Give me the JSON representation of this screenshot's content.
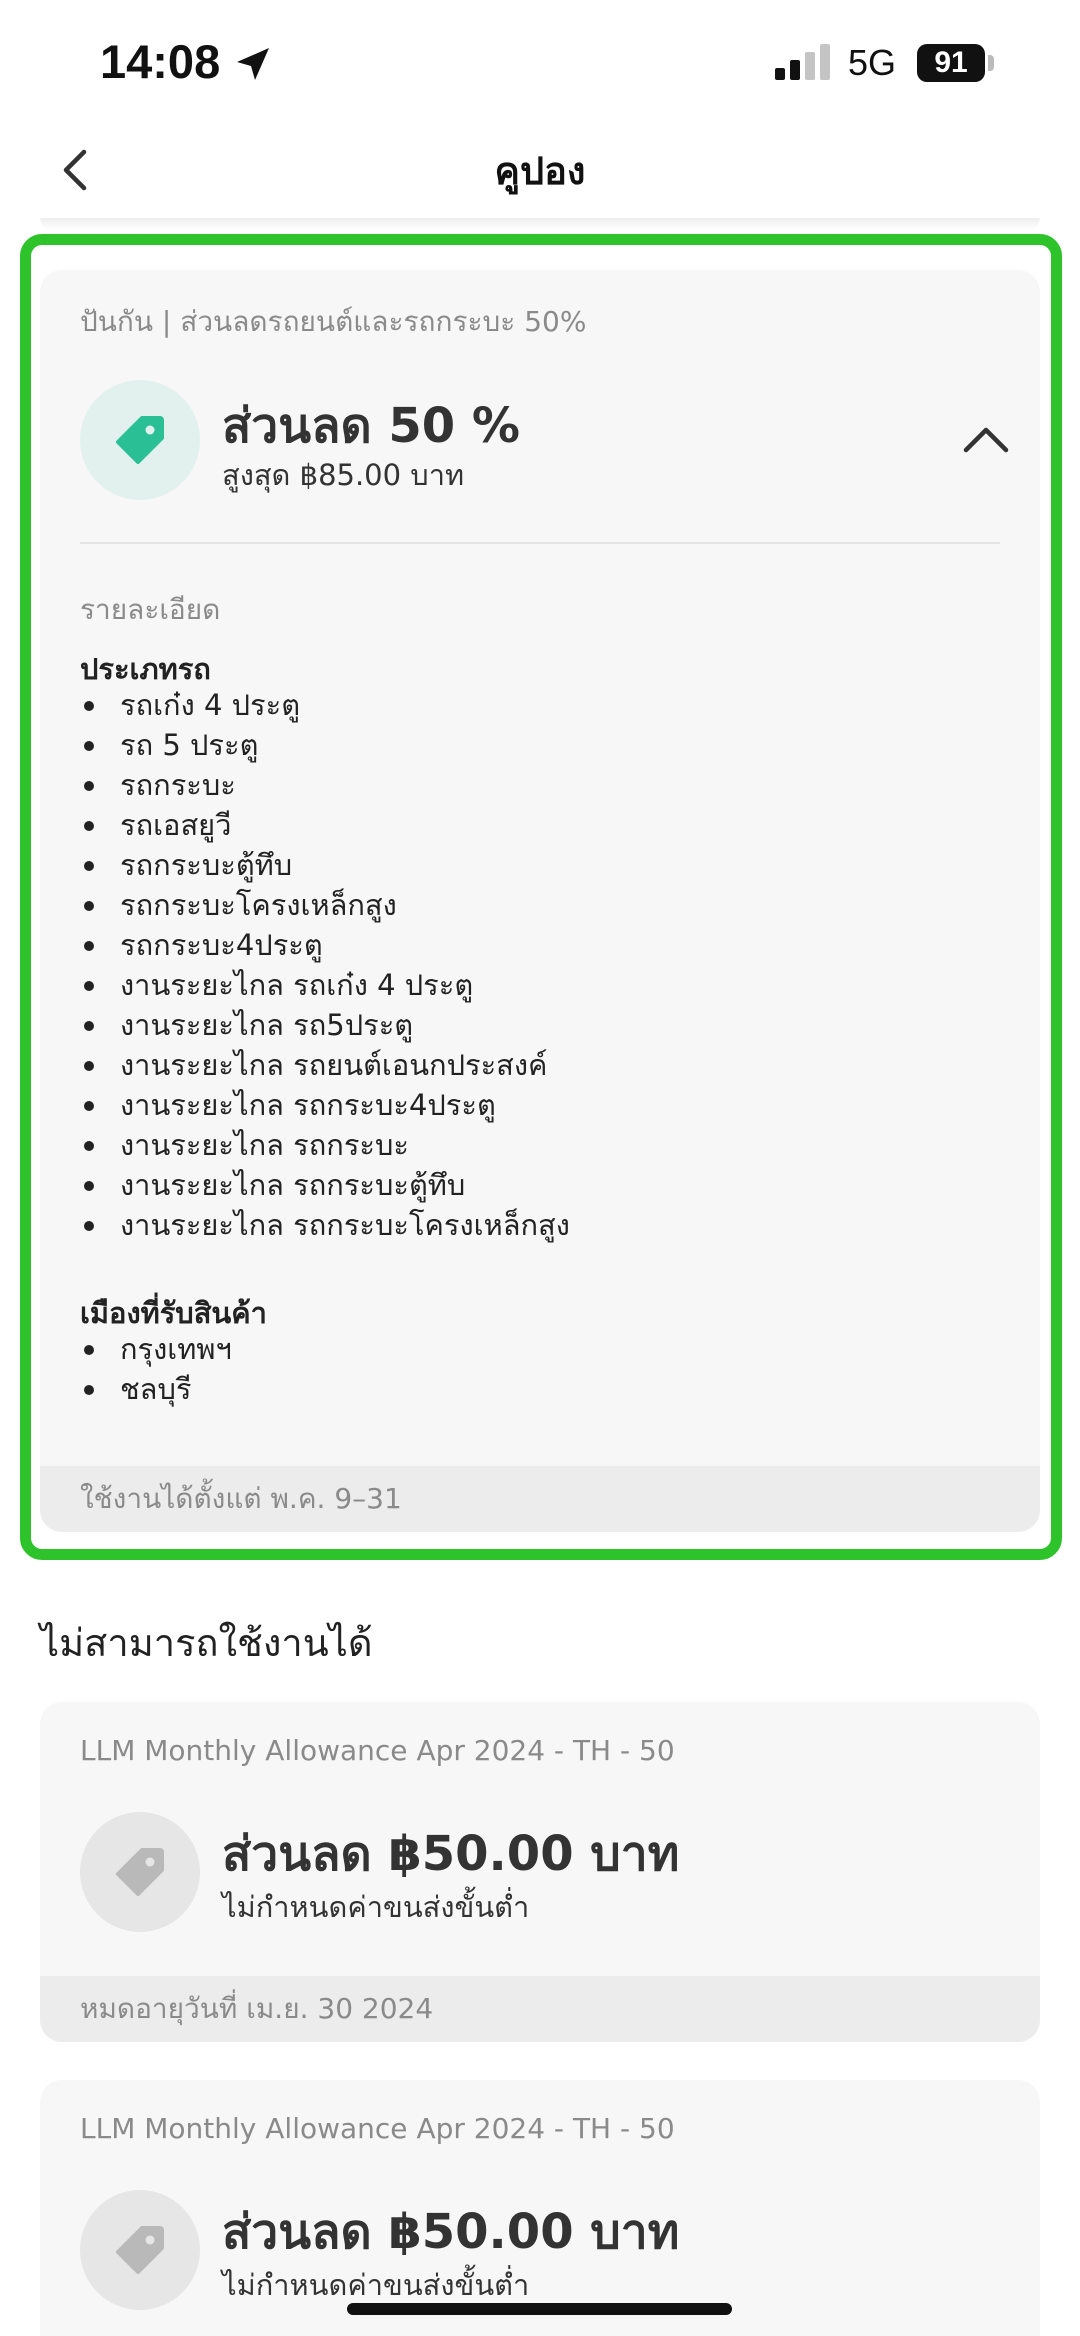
{
  "status_bar": {
    "time": "14:08",
    "network": "5G",
    "battery": "91"
  },
  "header": {
    "title": "คูปอง"
  },
  "selected_coupon": {
    "subtitle": "ปันกัน | ส่วนลดรถยนต์และรถกระบะ 50%",
    "title": "ส่วนลด 50 %",
    "max_discount": "สูงสุด ฿85.00 บาท",
    "details_label": "รายละเอียด",
    "vehicle_heading": "ประเภทรถ",
    "vehicles": [
      "รถเก๋ง 4 ประตู",
      "รถ 5 ประตู",
      "รถกระบะ",
      "รถเอสยูวี",
      "รถกระบะตู้ทึบ",
      "รถกระบะโครงเหล็กสูง",
      "รถกระบะ4ประตู",
      "งานระยะไกล รถเก๋ง 4 ประตู",
      "งานระยะไกล รถ5ประตู",
      "งานระยะไกล รถยนต์เอนกประสงค์",
      "งานระยะไกล รถกระบะ4ประตู",
      "งานระยะไกล รถกระบะ",
      "งานระยะไกล รถกระบะตู้ทึบ",
      "งานระยะไกล รถกระบะโครงเหล็กสูง"
    ],
    "city_heading": "เมืองที่รับสินค้า",
    "cities": [
      "กรุงเทพฯ",
      "ชลบุรี"
    ],
    "validity": "ใช้งานได้ตั้งแต่ พ.ค. 9–31",
    "accent_color": "#2ec22b",
    "tag_color": "#2bbf95"
  },
  "unavailable_heading": "ไม่สามารถใช้งานได้",
  "unavailable_coupons": [
    {
      "subtitle": "LLM Monthly Allowance Apr 2024 - TH - 50",
      "title": "ส่วนลด ฿50.00 บาท",
      "condition": "ไม่กำหนดค่าขนส่งขั้นต่ำ",
      "expiry": "หมดอายุวันที่ เม.ย. 30 2024"
    },
    {
      "subtitle": "LLM Monthly Allowance Apr 2024 - TH - 50",
      "title": "ส่วนลด ฿50.00 บาท",
      "condition": "ไม่กำหนดค่าขนส่งขั้นต่ำ"
    }
  ],
  "icons": {
    "location": "location-arrow-icon",
    "signal": "cellular-signal-icon",
    "back": "back-chevron-icon",
    "tag": "price-tag-icon",
    "collapse": "chevron-up-icon"
  }
}
